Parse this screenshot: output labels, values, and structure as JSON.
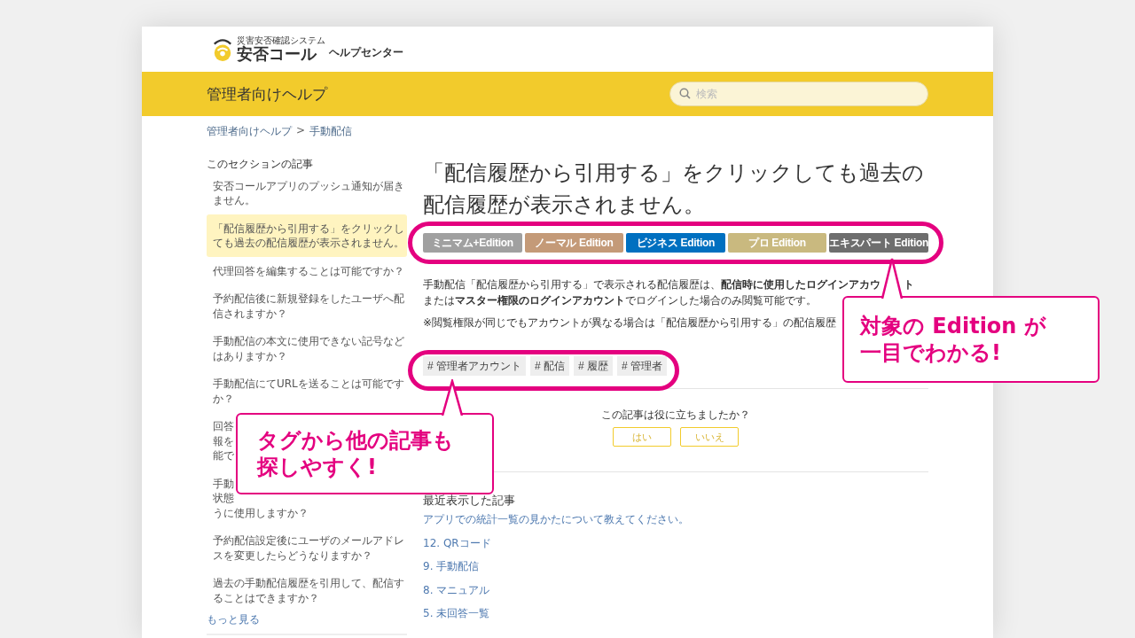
{
  "logo": {
    "tagline": "災害安否確認システム",
    "name": "安否コール",
    "suffix": "ヘルプセンター"
  },
  "header": {
    "title": "管理者向けヘルプ",
    "search": {
      "placeholder": "検索"
    }
  },
  "breadcrumbs": [
    "管理者向けヘルプ",
    "手動配信"
  ],
  "breadcrumb_separator": ">",
  "sidebar": {
    "heading": "このセクションの記事",
    "items": [
      {
        "text": "安否コールアプリのプッシュ通知が届きません。",
        "selected": false
      },
      {
        "text": "「配信履歴から引用する」をクリックしても過去の配信履歴が表示されません。",
        "selected": true
      },
      {
        "text": "代理回答を編集することは可能ですか？",
        "selected": false
      },
      {
        "text": "予約配信後に新規登録をしたユーザへ配信されますか？",
        "selected": false
      },
      {
        "text": "手動配信の本文に使用できない記号などはありますか？",
        "selected": false
      },
      {
        "text": "手動配信にてURLを送ることは可能ですか？",
        "selected": false
      },
      {
        "lines": [
          "回答",
          "報を",
          "能で"
        ],
        "selected": false
      },
      {
        "lines": [
          "手動",
          "状態",
          "うに使用しますか？"
        ],
        "selected": false
      },
      {
        "text": "予約配信設定後にユーザのメールアドレスを変更したらどうなりますか？",
        "selected": false
      },
      {
        "text": "過去の手動配信履歴を引用して、配信することはできますか？",
        "selected": false
      }
    ],
    "more_link": "もっと見る"
  },
  "article": {
    "title": "「配信履歴から引用する」をクリックしても過去の配信履歴が表示されません。",
    "editions": [
      {
        "label": "ミニマム+Edition",
        "color": "#a0a0a0"
      },
      {
        "label": "ノーマル Edition",
        "color": "#c49a78"
      },
      {
        "label": "ビジネス Edition",
        "color": "#0070c0"
      },
      {
        "label": "プロ Edition",
        "color": "#c9b97f"
      },
      {
        "label": "エキスパート Edition",
        "color": "#6e6e6e"
      }
    ],
    "paragraphs": [
      {
        "lines": [
          [
            "手動配信「配信履歴から引用する」で表示される配信履歴は、**配信時に使用したログインアカウ**",
            "**ト**"
          ],
          [
            "または**マスター権限のログインアカウント**でログインした場合のみ閲覧可能です。"
          ]
        ]
      },
      {
        "lines": [
          [
            "※閲覧権限が同じでもアカウントが異なる場合は「配信履歴から引用する」の配信履歴"
          ]
        ]
      }
    ],
    "tags": [
      "# 管理者アカウント",
      "# 配信",
      "# 履歴",
      "# 管理者"
    ]
  },
  "feedback": {
    "question": "この記事は役に立ちましたか？",
    "buttons": [
      "はい",
      "いいえ"
    ]
  },
  "recent": {
    "heading": "最近表示した記事",
    "links": [
      "アプリでの統計一覧の見かたについて教えてください。",
      "12. QRコード",
      "9. 手動配信",
      "8. マニュアル",
      "5. 未回答一覧"
    ]
  },
  "callouts": [
    {
      "lines": [
        "対象の Edition が",
        "一目でわかる!"
      ]
    },
    {
      "lines": [
        "タグから他の記事も",
        "探しやすく!"
      ]
    }
  ]
}
